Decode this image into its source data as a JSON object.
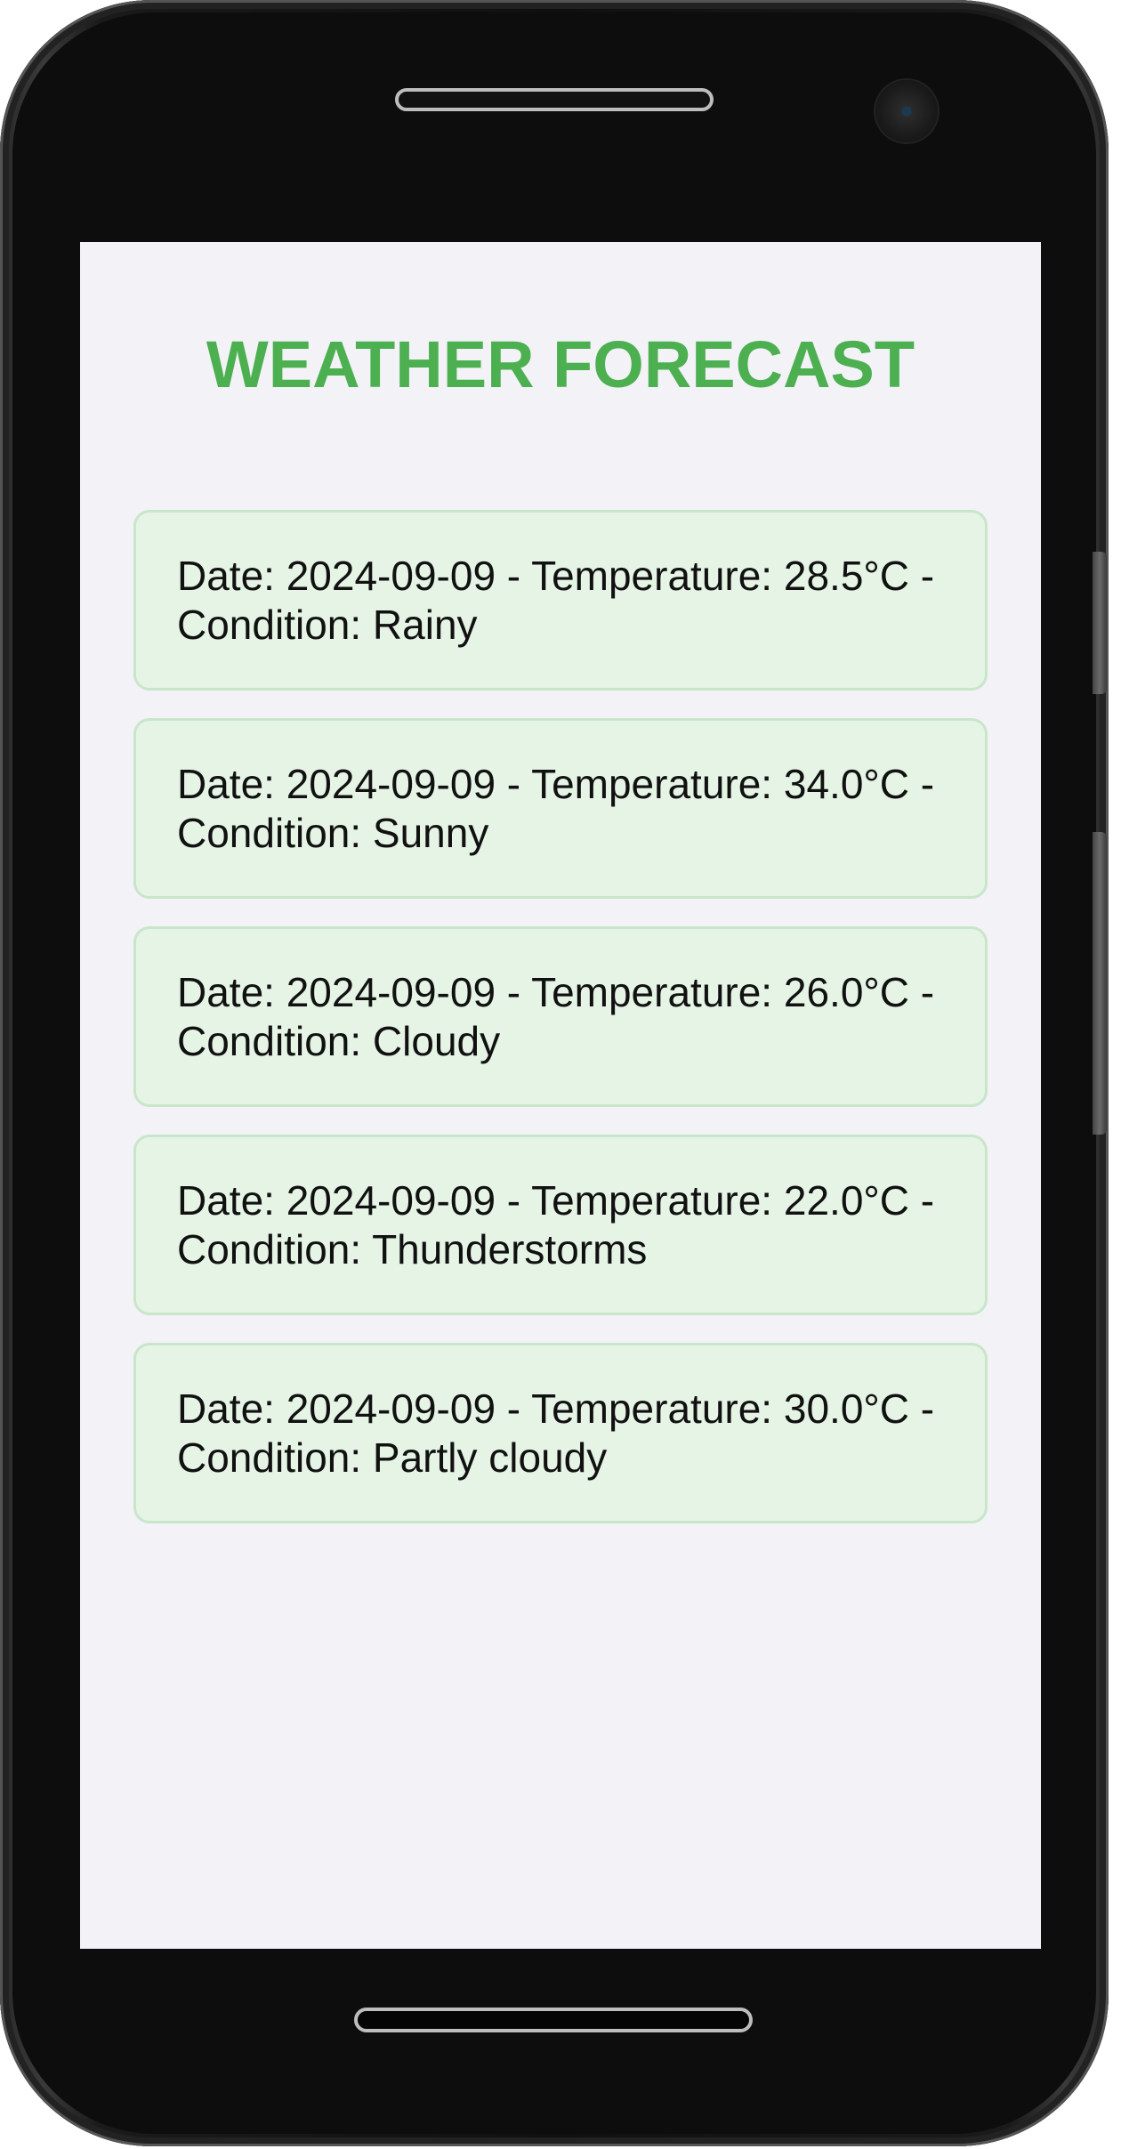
{
  "app": {
    "title": "WEATHER FORECAST"
  },
  "forecast": {
    "items": [
      {
        "text": "Date: 2024-09-09 - Temperature: 28.5°C - Condition: Rainy"
      },
      {
        "text": "Date: 2024-09-09 - Temperature: 34.0°C - Condition: Sunny"
      },
      {
        "text": "Date: 2024-09-09 - Temperature: 26.0°C - Condition: Cloudy"
      },
      {
        "text": "Date: 2024-09-09 - Temperature: 22.0°C - Condition: Thunderstorms"
      },
      {
        "text": "Date: 2024-09-09 - Temperature: 30.0°C - Condition: Partly cloudy"
      }
    ]
  },
  "colors": {
    "title": "#4caf50",
    "card_background": "#e6f4e6",
    "card_border": "#c8e6c9",
    "screen_background": "#f2f2f7"
  }
}
